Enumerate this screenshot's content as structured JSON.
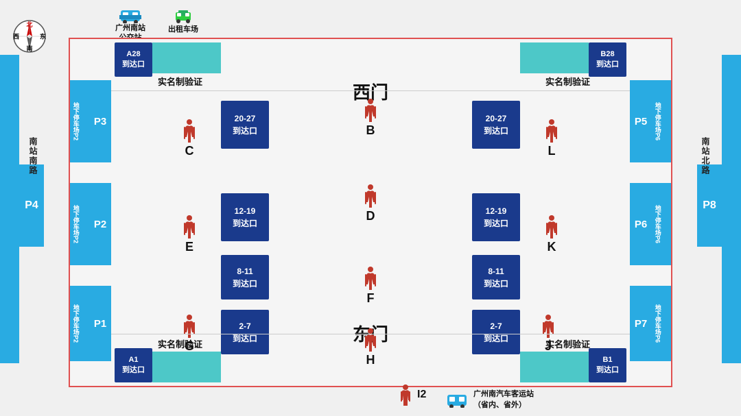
{
  "compass": {
    "north": "北",
    "south": "南",
    "east": "东",
    "west": "西"
  },
  "road_left": "南站南路",
  "road_right": "南站北路",
  "p4_label": "P4",
  "p8_label": "P8",
  "west_gate": "西门",
  "east_gate": "东门",
  "top_bus_label": "广州南站\n公交站",
  "top_taxi_label": "出租车场",
  "legend_i2": "I2",
  "legend_bus_label": "广州南汽车客运站\n（省内、省外）",
  "gates": {
    "A28": "A28\n到达口",
    "B28": "B28\n到达口",
    "A1": "A1\n到达口",
    "B1": "B1\n到达口"
  },
  "arrival_boxes_left": [
    {
      "id": "box_20_27_left",
      "text": "20-27\n到达口"
    },
    {
      "id": "box_12_19_left",
      "text": "12-19\n到达口"
    },
    {
      "id": "box_8_11_left",
      "text": "8-11\n到达口"
    },
    {
      "id": "box_2_7_left",
      "text": "2-7\n到达口"
    }
  ],
  "arrival_boxes_right": [
    {
      "id": "box_20_27_right",
      "text": "20-27\n到达口"
    },
    {
      "id": "box_12_19_right",
      "text": "12-19\n到达口"
    },
    {
      "id": "box_8_11_right",
      "text": "8-11\n到达口"
    },
    {
      "id": "box_2_7_right",
      "text": "2-7\n到达口"
    }
  ],
  "gate_letters": [
    "B",
    "D",
    "F",
    "H",
    "C",
    "E",
    "G",
    "K",
    "L",
    "J"
  ],
  "parking_left": [
    {
      "label": "P3",
      "sub": "地下\n停车场\nP2"
    },
    {
      "label": "P2",
      "sub": "地下\n停车场\nP2"
    },
    {
      "label": "P1",
      "sub": "地下\n停车场\nP2"
    }
  ],
  "parking_right": [
    {
      "label": "P5",
      "sub": "地下\n停车场\nP6"
    },
    {
      "label": "P6",
      "sub": "地下\n停车场\nP6"
    },
    {
      "label": "P7",
      "sub": "地下\n停车场\nP6"
    }
  ],
  "verify_top_left": "实名制验证",
  "verify_top_right": "实名制验证",
  "verify_bottom_left": "实名制验证",
  "verify_bottom_right": "实名制验证"
}
